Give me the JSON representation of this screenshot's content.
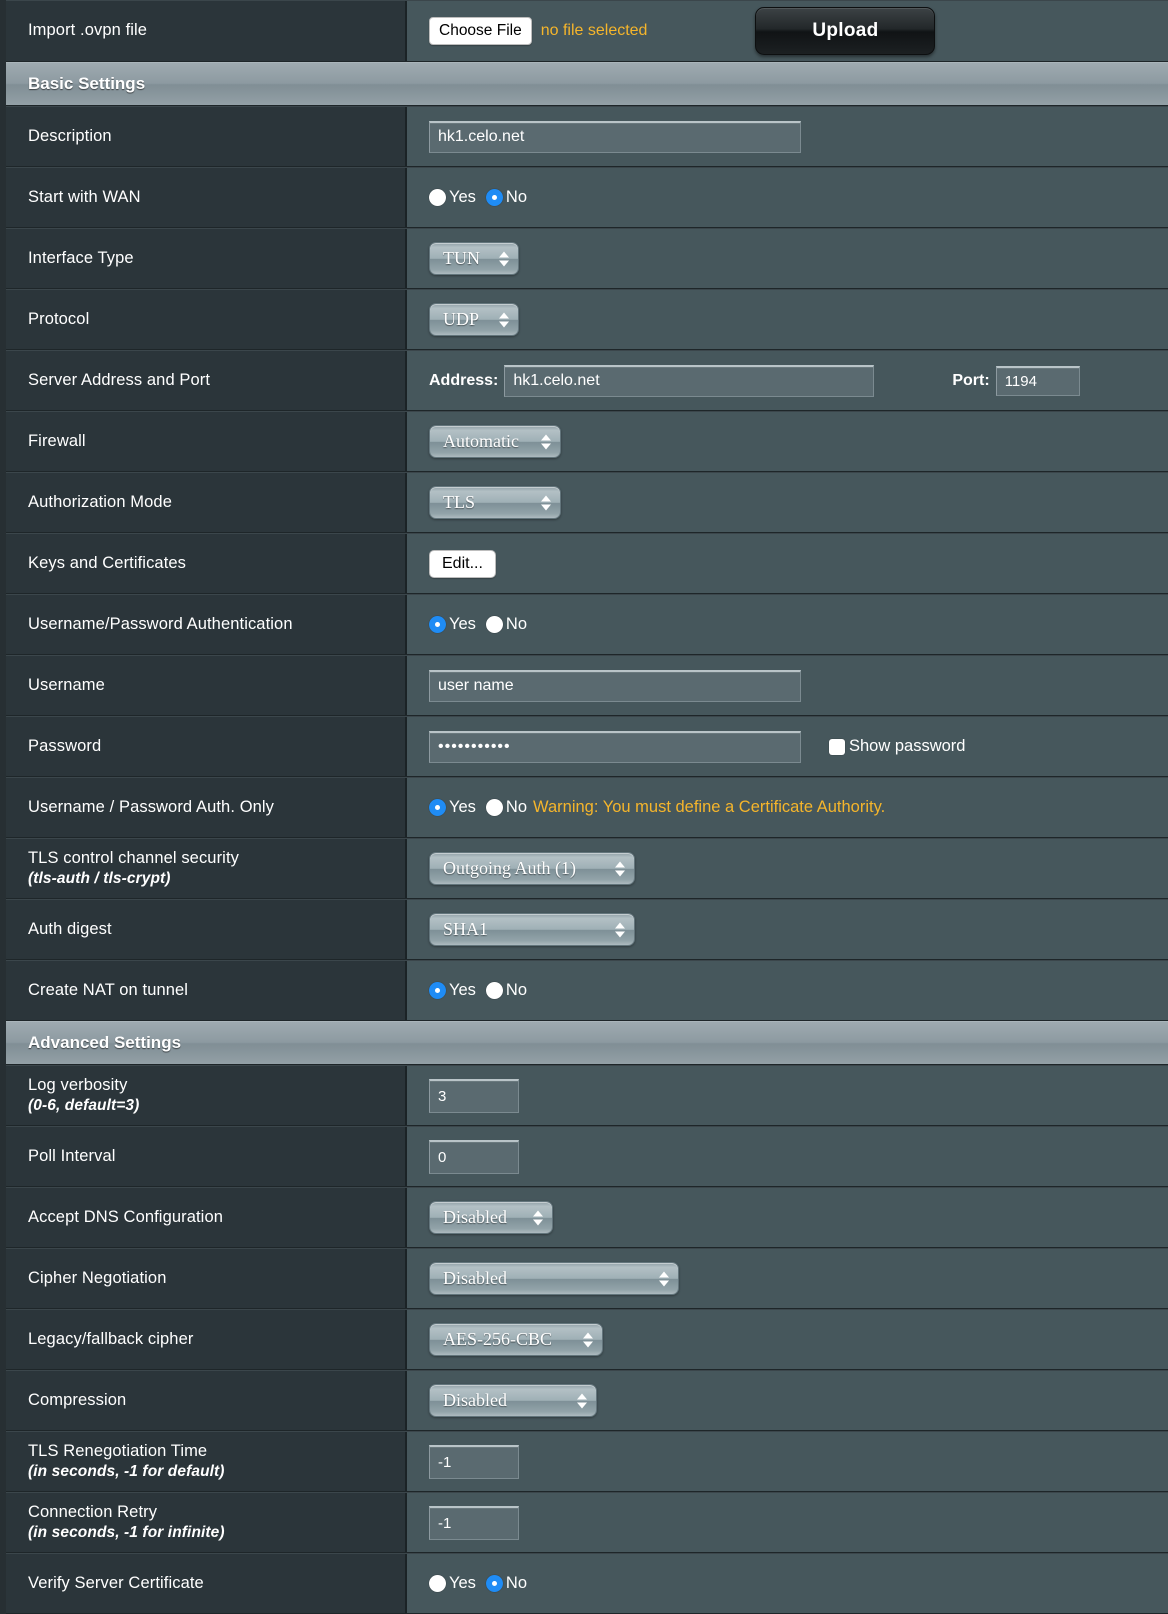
{
  "colors": {
    "label_bg": "#2b353a",
    "field_bg": "#46575c",
    "section_bg": "#8d9aa1",
    "accent_blue": "#1f8cf5",
    "warning_yellow": "#f5b52b",
    "text": "#ffffff"
  },
  "import_row": {
    "label": "Import .ovpn file",
    "choose_file_label": "Choose File",
    "file_status": "no file selected",
    "upload_label": "Upload"
  },
  "sections": [
    {
      "title": "Basic Settings"
    },
    {
      "title": "Advanced Settings"
    }
  ],
  "basic": {
    "description": {
      "label": "Description",
      "value": "hk1.celo.net"
    },
    "start_with_wan": {
      "label": "Start with WAN",
      "options": [
        "Yes",
        "No"
      ],
      "selected": "No"
    },
    "interface_type": {
      "label": "Interface Type",
      "value": "TUN"
    },
    "protocol": {
      "label": "Protocol",
      "value": "UDP"
    },
    "server": {
      "label": "Server Address and Port",
      "address_label": "Address:",
      "address_value": "hk1.celo.net",
      "port_label": "Port:",
      "port_value": "1194"
    },
    "firewall": {
      "label": "Firewall",
      "value": "Automatic"
    },
    "auth_mode": {
      "label": "Authorization Mode",
      "value": "TLS"
    },
    "keys_certs": {
      "label": "Keys and Certificates",
      "button_label": "Edit..."
    },
    "userpass_auth": {
      "label": "Username/Password Authentication",
      "options": [
        "Yes",
        "No"
      ],
      "selected": "Yes"
    },
    "username": {
      "label": "Username",
      "value": "user name"
    },
    "password": {
      "label": "Password",
      "value": "•••••••••••",
      "show_password_label": "Show password",
      "show_password_checked": false
    },
    "userpass_only": {
      "label": "Username / Password Auth. Only",
      "options": [
        "Yes",
        "No"
      ],
      "selected": "Yes",
      "warning": "Warning: You must define a Certificate Authority."
    },
    "tls_control": {
      "label": "TLS control channel security",
      "sublabel": "(tls-auth / tls-crypt)",
      "value": "Outgoing Auth (1)"
    },
    "auth_digest": {
      "label": "Auth digest",
      "value": "SHA1"
    },
    "create_nat": {
      "label": "Create NAT on tunnel",
      "options": [
        "Yes",
        "No"
      ],
      "selected": "Yes"
    }
  },
  "advanced": {
    "log_verbosity": {
      "label": "Log verbosity",
      "sublabel": "(0-6, default=3)",
      "value": "3"
    },
    "poll_interval": {
      "label": "Poll Interval",
      "value": "0"
    },
    "accept_dns": {
      "label": "Accept DNS Configuration",
      "value": "Disabled"
    },
    "cipher_negotiation": {
      "label": "Cipher Negotiation",
      "value": "Disabled"
    },
    "legacy_cipher": {
      "label": "Legacy/fallback cipher",
      "value": "AES-256-CBC"
    },
    "compression": {
      "label": "Compression",
      "value": "Disabled"
    },
    "tls_renegotiation": {
      "label": "TLS Renegotiation Time",
      "sublabel": "(in seconds, -1 for default)",
      "value": "-1"
    },
    "connection_retry": {
      "label": "Connection Retry",
      "sublabel": "(in seconds, -1 for infinite)",
      "value": "-1"
    },
    "verify_server_cert": {
      "label": "Verify Server Certificate",
      "options": [
        "Yes",
        "No"
      ],
      "selected": "No"
    }
  }
}
